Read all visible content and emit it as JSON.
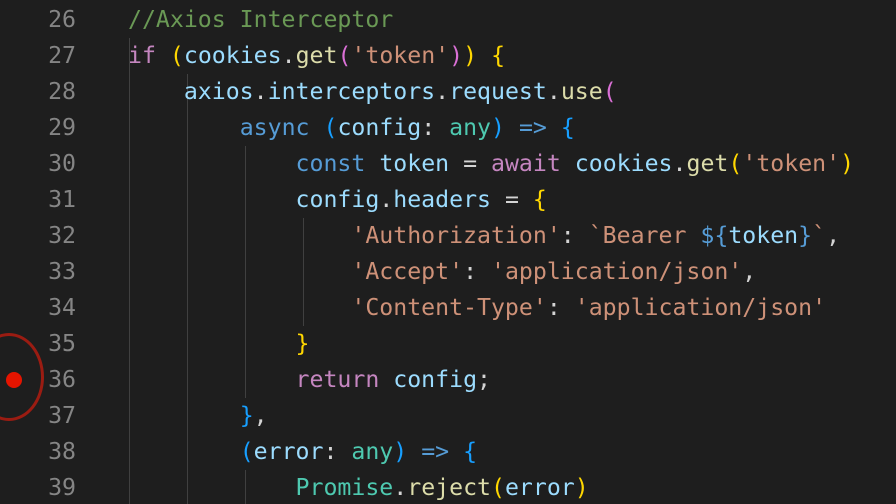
{
  "editor": {
    "theme_colors": {
      "background": "#1e1e1e",
      "line_number": "#858585",
      "comment": "#6a9955",
      "keyword": "#569cd6",
      "control": "#c586c0",
      "variable": "#9cdcfe",
      "function": "#dcdcaa",
      "string": "#ce9178",
      "type": "#4ec9b0",
      "bracket_level_1": "#ffd700",
      "bracket_level_2": "#da70d6",
      "bracket_level_3": "#179fff",
      "breakpoint": "#e51400"
    },
    "breakpoint_line": "36",
    "lines": [
      {
        "number": "26",
        "tokens": [
          {
            "t": "//Axios Interceptor",
            "c": "comment"
          }
        ]
      },
      {
        "number": "27",
        "tokens": [
          {
            "t": "if",
            "c": "control"
          },
          {
            "t": " ",
            "c": "plain"
          },
          {
            "t": "(",
            "c": "bracket1"
          },
          {
            "t": "cookies",
            "c": "variable"
          },
          {
            "t": ".",
            "c": "plain"
          },
          {
            "t": "get",
            "c": "function"
          },
          {
            "t": "(",
            "c": "bracket2"
          },
          {
            "t": "'token'",
            "c": "string"
          },
          {
            "t": ")",
            "c": "bracket2"
          },
          {
            "t": ")",
            "c": "bracket1"
          },
          {
            "t": " ",
            "c": "plain"
          },
          {
            "t": "{",
            "c": "bracket1"
          }
        ]
      },
      {
        "number": "28",
        "tokens": [
          {
            "t": "    ",
            "c": "plain"
          },
          {
            "t": "axios",
            "c": "variable"
          },
          {
            "t": ".",
            "c": "plain"
          },
          {
            "t": "interceptors",
            "c": "variable"
          },
          {
            "t": ".",
            "c": "plain"
          },
          {
            "t": "request",
            "c": "variable"
          },
          {
            "t": ".",
            "c": "plain"
          },
          {
            "t": "use",
            "c": "function"
          },
          {
            "t": "(",
            "c": "bracket2"
          }
        ]
      },
      {
        "number": "29",
        "tokens": [
          {
            "t": "        ",
            "c": "plain"
          },
          {
            "t": "async",
            "c": "keyword"
          },
          {
            "t": " ",
            "c": "plain"
          },
          {
            "t": "(",
            "c": "bracket3"
          },
          {
            "t": "config",
            "c": "variable"
          },
          {
            "t": ": ",
            "c": "plain"
          },
          {
            "t": "any",
            "c": "type"
          },
          {
            "t": ")",
            "c": "bracket3"
          },
          {
            "t": " ",
            "c": "plain"
          },
          {
            "t": "=>",
            "c": "keyword"
          },
          {
            "t": " ",
            "c": "plain"
          },
          {
            "t": "{",
            "c": "bracket3"
          }
        ]
      },
      {
        "number": "30",
        "tokens": [
          {
            "t": "            ",
            "c": "plain"
          },
          {
            "t": "const",
            "c": "keyword"
          },
          {
            "t": " ",
            "c": "plain"
          },
          {
            "t": "token",
            "c": "variable"
          },
          {
            "t": " = ",
            "c": "plain"
          },
          {
            "t": "await",
            "c": "control"
          },
          {
            "t": " ",
            "c": "plain"
          },
          {
            "t": "cookies",
            "c": "variable"
          },
          {
            "t": ".",
            "c": "plain"
          },
          {
            "t": "get",
            "c": "function"
          },
          {
            "t": "(",
            "c": "bracket1"
          },
          {
            "t": "'token'",
            "c": "string"
          },
          {
            "t": ")",
            "c": "bracket1"
          }
        ]
      },
      {
        "number": "31",
        "tokens": [
          {
            "t": "            ",
            "c": "plain"
          },
          {
            "t": "config",
            "c": "variable"
          },
          {
            "t": ".",
            "c": "plain"
          },
          {
            "t": "headers",
            "c": "variable"
          },
          {
            "t": " = ",
            "c": "plain"
          },
          {
            "t": "{",
            "c": "bracket1"
          }
        ]
      },
      {
        "number": "32",
        "tokens": [
          {
            "t": "                ",
            "c": "plain"
          },
          {
            "t": "'Authorization'",
            "c": "string"
          },
          {
            "t": ": ",
            "c": "plain"
          },
          {
            "t": "`Bearer ",
            "c": "string"
          },
          {
            "t": "${",
            "c": "keyword"
          },
          {
            "t": "token",
            "c": "variable"
          },
          {
            "t": "}",
            "c": "keyword"
          },
          {
            "t": "`",
            "c": "string"
          },
          {
            "t": ",",
            "c": "plain"
          }
        ]
      },
      {
        "number": "33",
        "tokens": [
          {
            "t": "                ",
            "c": "plain"
          },
          {
            "t": "'Accept'",
            "c": "string"
          },
          {
            "t": ": ",
            "c": "plain"
          },
          {
            "t": "'application/json'",
            "c": "string"
          },
          {
            "t": ",",
            "c": "plain"
          }
        ]
      },
      {
        "number": "34",
        "tokens": [
          {
            "t": "                ",
            "c": "plain"
          },
          {
            "t": "'Content-Type'",
            "c": "string"
          },
          {
            "t": ": ",
            "c": "plain"
          },
          {
            "t": "'application/json'",
            "c": "string"
          }
        ]
      },
      {
        "number": "35",
        "tokens": [
          {
            "t": "            ",
            "c": "plain"
          },
          {
            "t": "}",
            "c": "bracket1"
          }
        ]
      },
      {
        "number": "36",
        "tokens": [
          {
            "t": "            ",
            "c": "plain"
          },
          {
            "t": "return",
            "c": "control"
          },
          {
            "t": " ",
            "c": "plain"
          },
          {
            "t": "config",
            "c": "variable"
          },
          {
            "t": ";",
            "c": "plain"
          }
        ]
      },
      {
        "number": "37",
        "tokens": [
          {
            "t": "        ",
            "c": "plain"
          },
          {
            "t": "}",
            "c": "bracket3"
          },
          {
            "t": ",",
            "c": "plain"
          }
        ]
      },
      {
        "number": "38",
        "tokens": [
          {
            "t": "        ",
            "c": "plain"
          },
          {
            "t": "(",
            "c": "bracket3"
          },
          {
            "t": "error",
            "c": "variable"
          },
          {
            "t": ": ",
            "c": "plain"
          },
          {
            "t": "any",
            "c": "type"
          },
          {
            "t": ")",
            "c": "bracket3"
          },
          {
            "t": " ",
            "c": "plain"
          },
          {
            "t": "=>",
            "c": "keyword"
          },
          {
            "t": " ",
            "c": "plain"
          },
          {
            "t": "{",
            "c": "bracket3"
          }
        ]
      },
      {
        "number": "39",
        "tokens": [
          {
            "t": "            ",
            "c": "plain"
          },
          {
            "t": "Promise",
            "c": "type"
          },
          {
            "t": ".",
            "c": "plain"
          },
          {
            "t": "reject",
            "c": "function"
          },
          {
            "t": "(",
            "c": "bracket1"
          },
          {
            "t": "error",
            "c": "variable"
          },
          {
            "t": ")",
            "c": "bracket1"
          }
        ]
      }
    ]
  }
}
